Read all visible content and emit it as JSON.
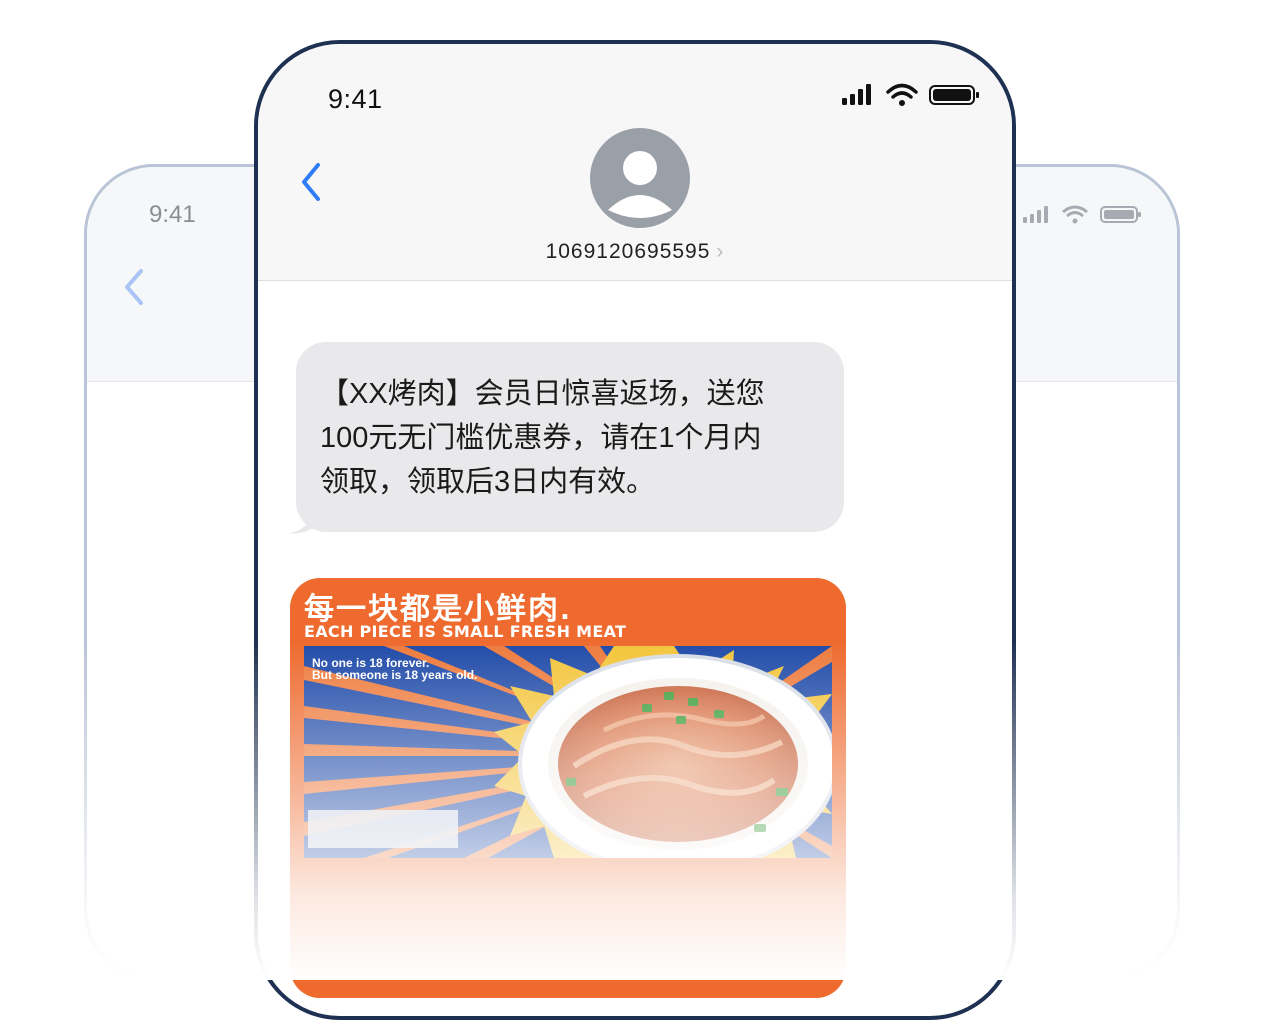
{
  "background_phone": {
    "time": "9:41"
  },
  "status_bar": {
    "time": "9:41"
  },
  "conversation": {
    "sender": "1069120695595",
    "sender_chevron": "›"
  },
  "message": {
    "text_line1": "【XX烤肉】会员日惊喜返场，送您",
    "text_line2": "100元无门槛优惠券，请在1个月内",
    "text_line3": "领取，领取后3日内有效。"
  },
  "mms_image": {
    "headline": "每一块都是小鲜肉",
    "headline_dot": ".",
    "subheadline": "EACH PIECE IS SMALL FRESH MEAT",
    "tagline_1": "No one is 18 forever.",
    "tagline_2": "But someone is 18 years old."
  },
  "colors": {
    "accent_blue": "#2f7cf6",
    "phone_frame": "#1f3152",
    "bubble_gray": "#e9e9eb",
    "poster_orange": "#ee6a2e",
    "poster_blue": "#1f4aa8",
    "poster_yellow": "#f3c53a"
  },
  "icons": [
    "cellular-signal-icon",
    "wifi-icon",
    "battery-icon",
    "back-chevron-icon",
    "contact-avatar-icon"
  ]
}
